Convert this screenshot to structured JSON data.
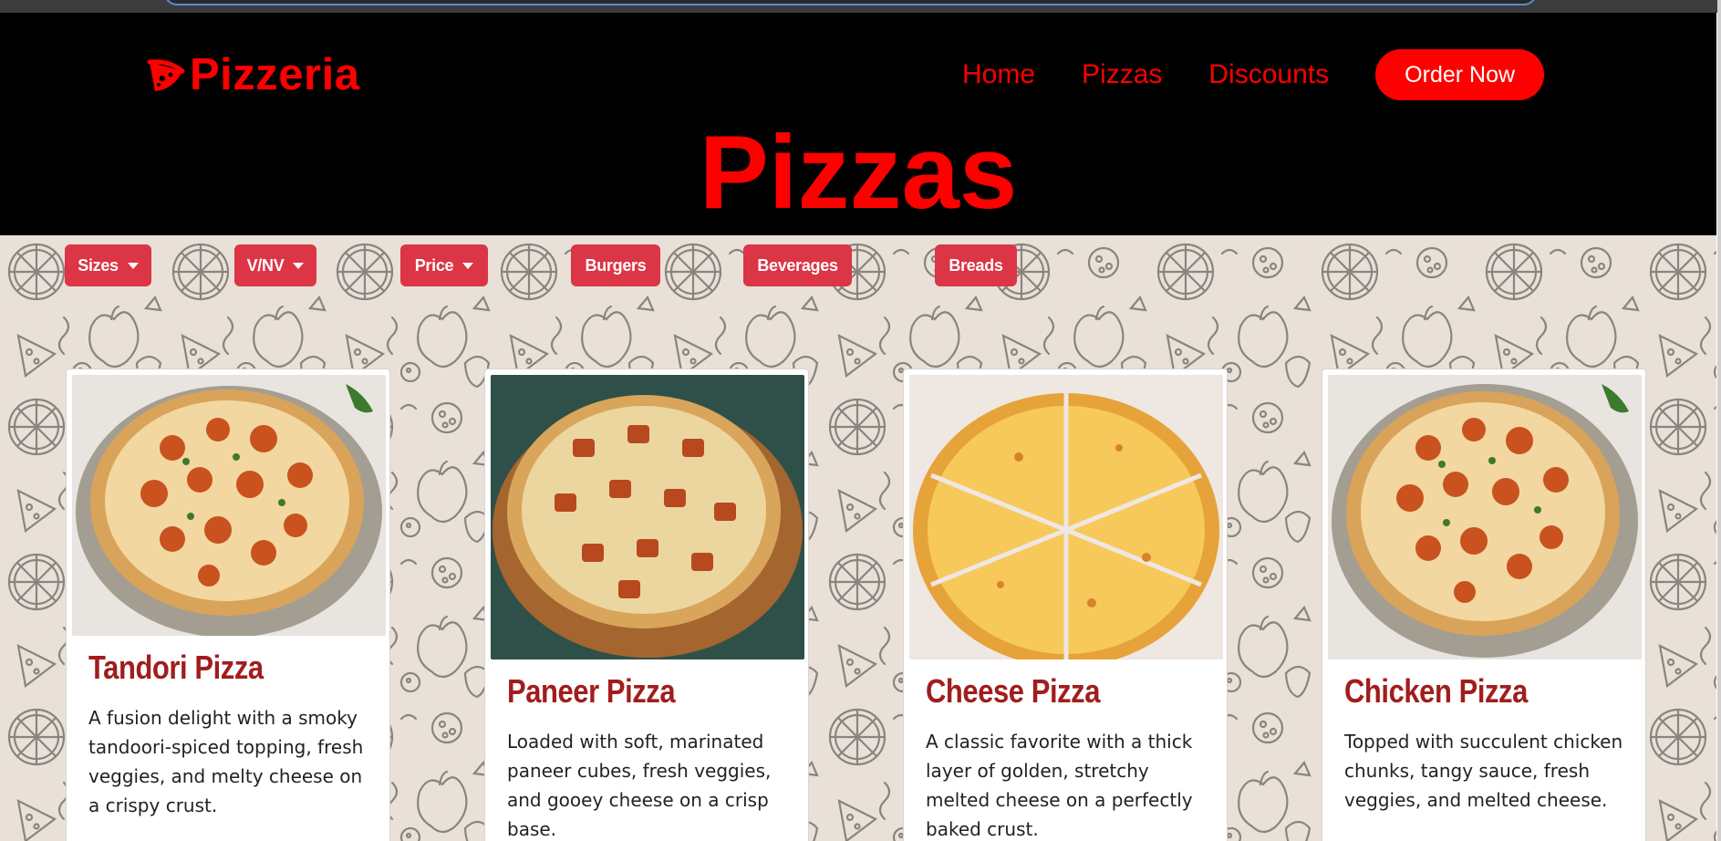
{
  "brand": {
    "name": "Pizzeria",
    "icon": "pizza-slice-icon",
    "color": "#ff0000"
  },
  "nav": {
    "links": [
      "Home",
      "Pizzas",
      "Discounts"
    ],
    "cta": "Order Now"
  },
  "page": {
    "heading": "Pizzas"
  },
  "filters": [
    {
      "label": "Sizes",
      "dropdown": true
    },
    {
      "label": "V/NV",
      "dropdown": true
    },
    {
      "label": "Price",
      "dropdown": true
    },
    {
      "label": "Burgers",
      "dropdown": false
    },
    {
      "label": "Beverages",
      "dropdown": false
    },
    {
      "label": "Breads",
      "dropdown": false
    }
  ],
  "products": [
    {
      "title": "Tandori Pizza",
      "description": "A fusion delight with a smoky tandoori-spiced topping, fresh veggies, and melty cheese on a crispy crust.",
      "image": "tandoori-pizza-photo"
    },
    {
      "title": "Paneer Pizza",
      "description": "Loaded with soft, marinated paneer cubes, fresh veggies, and gooey cheese on a crisp base.",
      "image": "paneer-pizza-photo"
    },
    {
      "title": "Cheese Pizza",
      "description": "A classic favorite with a thick layer of golden, stretchy melted cheese on a perfectly baked crust.",
      "image": "cheese-pizza-photo"
    },
    {
      "title": "Chicken Pizza",
      "description": "Topped with succulent chicken chunks, tangy sauce, fresh veggies, and melted cheese.",
      "image": "chicken-pizza-photo"
    }
  ],
  "colors": {
    "header_bg": "#000000",
    "accent": "#ff0000",
    "filter_bg": "#dc3545",
    "title": "#a11d1d",
    "pattern_bg": "#e9e1d8"
  }
}
